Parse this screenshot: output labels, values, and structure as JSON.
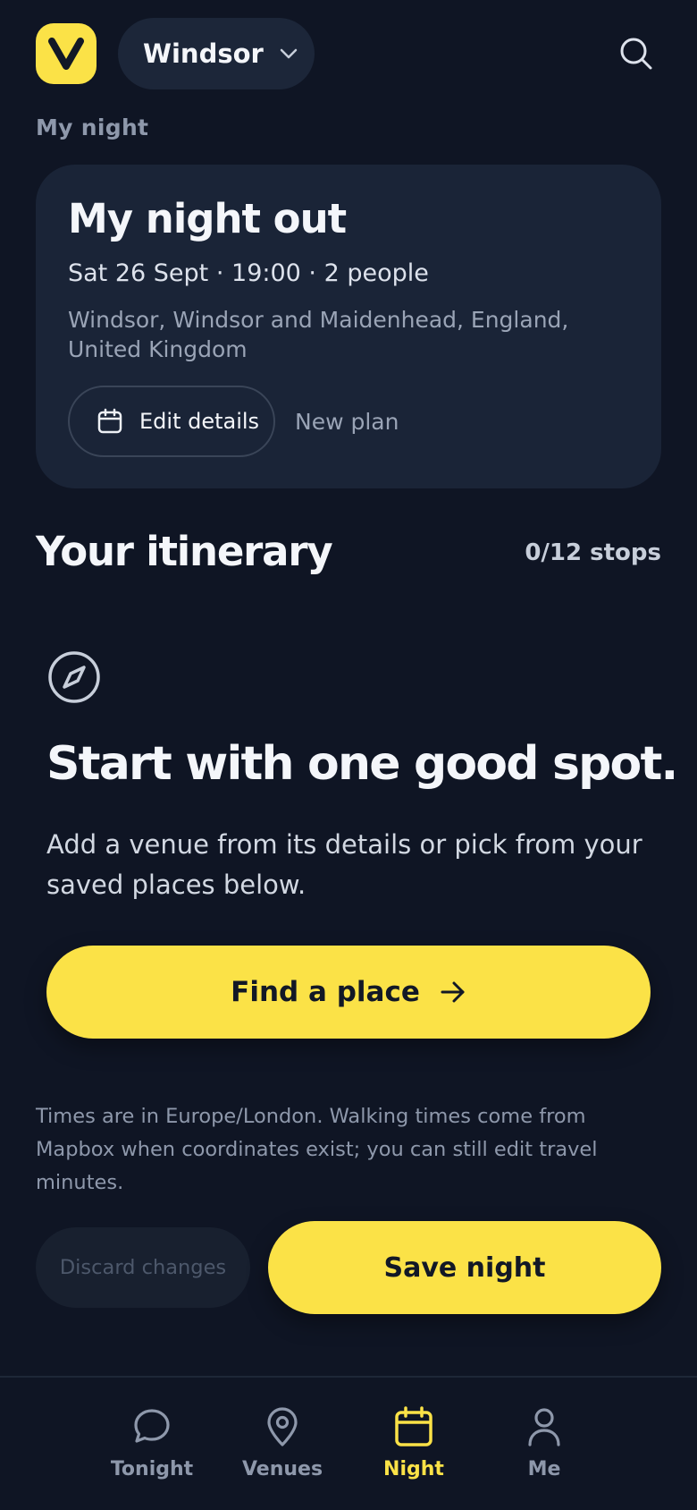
{
  "header": {
    "logo_letter": "V",
    "city": "Windsor"
  },
  "section_label": "My night",
  "card": {
    "title": "My night out",
    "meta": "Sat 26 Sept · 19:00 · 2 people",
    "location": "Windsor, Windsor and Maidenhead, England, United Kingdom",
    "edit_label": "Edit details",
    "new_plan_label": "New plan"
  },
  "itinerary": {
    "title": "Your itinerary",
    "count": "0/12 stops"
  },
  "empty_state": {
    "title": "Start with one good spot.",
    "subtitle": "Add a venue from its details or pick from your saved places below.",
    "cta_label": "Find a place"
  },
  "note": "Times are in Europe/London. Walking times come from Mapbox when coordinates exist; you can still edit travel minutes.",
  "actions": {
    "discard_label": "Discard changes",
    "save_label": "Save night"
  },
  "nav": {
    "items": [
      {
        "label": "Tonight",
        "icon": "chat-bubble-icon",
        "active": false
      },
      {
        "label": "Venues",
        "icon": "map-pin-icon",
        "active": false
      },
      {
        "label": "Night",
        "icon": "calendar-icon",
        "active": true
      },
      {
        "label": "Me",
        "icon": "user-icon",
        "active": false
      }
    ]
  },
  "colors": {
    "background": "#0f1524",
    "card": "#1a2437",
    "accent": "#fbe247",
    "muted": "#8e98ab"
  }
}
